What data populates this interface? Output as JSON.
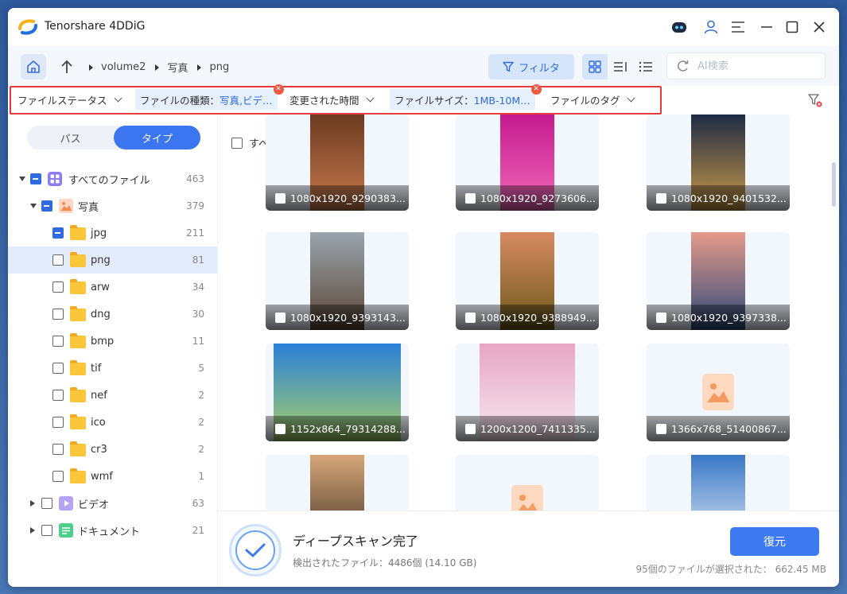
{
  "app": {
    "title": "Tenorshare 4DDiG"
  },
  "breadcrumb": [
    "volume2",
    "写真",
    "png"
  ],
  "toolbar": {
    "filter_label": "フィルタ",
    "search_placeholder": "AI検索"
  },
  "filters": [
    {
      "label": "ファイルステータス",
      "value": ""
    },
    {
      "label": "ファイルの種類：",
      "value": "写真,ビデ…"
    },
    {
      "label": "変更された時間",
      "value": ""
    },
    {
      "label": "ファイルサイズ：",
      "value": "1MB-10M…"
    },
    {
      "label": "ファイルのタグ",
      "value": ""
    }
  ],
  "sidebar": {
    "tabs": [
      "パス",
      "タイプ"
    ],
    "active_tab": "タイプ",
    "tree": [
      {
        "label": "すべてのファイル",
        "count": "463"
      },
      {
        "label": "写真",
        "count": "379"
      },
      {
        "label": "jpg",
        "count": "211"
      },
      {
        "label": "png",
        "count": "81"
      },
      {
        "label": "arw",
        "count": "34"
      },
      {
        "label": "dng",
        "count": "30"
      },
      {
        "label": "bmp",
        "count": "11"
      },
      {
        "label": "tif",
        "count": "5"
      },
      {
        "label": "nef",
        "count": "2"
      },
      {
        "label": "ico",
        "count": "2"
      },
      {
        "label": "cr3",
        "count": "2"
      },
      {
        "label": "wmf",
        "count": "1"
      },
      {
        "label": "ビデオ",
        "count": "63"
      },
      {
        "label": "ドキュメント",
        "count": "21"
      }
    ]
  },
  "grid": {
    "select_all": "すべて選択",
    "tiles": [
      {
        "name": "1080x1920_9290383...",
        "colors": [
          "#6b3a20",
          "#c97b4f"
        ]
      },
      {
        "name": "1080x1920_9273606...",
        "colors": [
          "#c51a8e",
          "#f06ab8"
        ]
      },
      {
        "name": "1080x1920_9401532...",
        "colors": [
          "#1d2a44",
          "#c99a4a"
        ]
      },
      {
        "name": "1080x1920_9393143...",
        "colors": [
          "#9aa4ad",
          "#5b4637"
        ]
      },
      {
        "name": "1080x1920_9388949...",
        "colors": [
          "#d88a62",
          "#6a5a1a"
        ]
      },
      {
        "name": "1080x1920_9397338...",
        "colors": [
          "#e59a8a",
          "#2d4a7a"
        ]
      },
      {
        "name": "1152x864_79314288...",
        "colors": [
          "#2a7fd8",
          "#a8d06a"
        ]
      },
      {
        "name": "1200x1200_7411335...",
        "colors": [
          "#e7a6c4",
          "#f6e8ef"
        ]
      },
      {
        "name": "1366x768_51400867...",
        "colors": []
      },
      {
        "name": "",
        "colors": [
          "#d6a678",
          "#3b3024"
        ]
      },
      {
        "name": "",
        "colors": []
      },
      {
        "name": "",
        "colors": [
          "#3a78c6",
          "#e8eef6"
        ]
      }
    ]
  },
  "footer": {
    "status_title": "ディープスキャン完了",
    "status_sub": "検出されたファイル：4486個 (14.10 GB)",
    "recover_label": "復元",
    "selection_info": "95個のファイルが選択された：  662.45 MB"
  },
  "colors": {
    "accent": "#3d7af2",
    "highlight_outline": "#e53b3b"
  }
}
